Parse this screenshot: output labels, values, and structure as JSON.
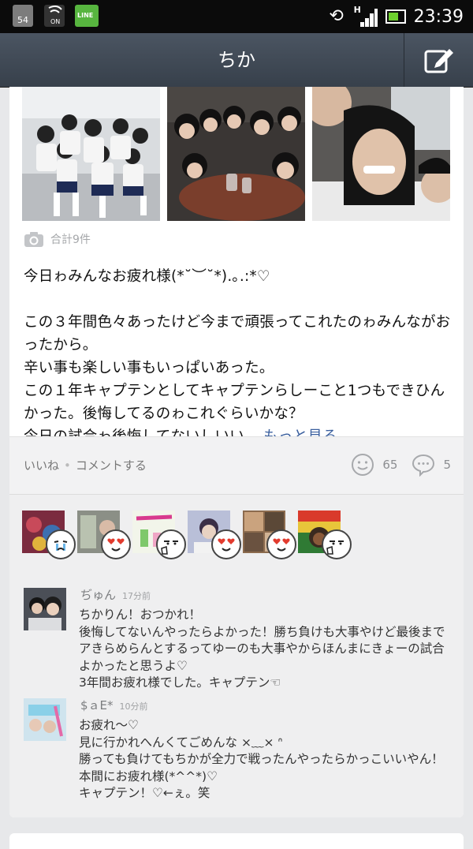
{
  "status_bar": {
    "calendar_day": "54",
    "on_label": "ON",
    "line_label": "LINE",
    "network": "H",
    "time": "23:39"
  },
  "header": {
    "title": "ちか",
    "compose_icon": "compose-icon"
  },
  "post": {
    "photo_count_label": "合計9件",
    "paragraphs": [
      "今日ゎみんなお疲れ様(*˘︶˘*).｡.:*♡",
      "この３年間色々あったけど今まで頑張ってこれたのゎみんながおったから。\n辛い事も楽しい事もいっぱいあった。\nこの１年キャプテンとしてキャプテンらしーこと1つもできひんかった。後悔してるのゎこれぐらいかな？"
    ],
    "last_line": "今日の試合ゎ後悔してないしいい...",
    "more_label": "もっと見る"
  },
  "actions": {
    "like_label": "いいね",
    "comment_label": "コメントする",
    "like_count": "65",
    "comment_count": "5"
  },
  "reactions": [
    {
      "emoji": "crying-face"
    },
    {
      "emoji": "heart-eyes"
    },
    {
      "emoji": "thumbs-up-face"
    },
    {
      "emoji": "heart-eyes"
    },
    {
      "emoji": "heart-eyes"
    },
    {
      "emoji": "thumbs-up-face"
    }
  ],
  "comments": [
    {
      "name": "ぢゅん",
      "time": "17分前",
      "text": "ちかりん！おつかれ！\n後悔してないんやったらよかった！勝ち負けも大事やけど最後までアきらめらんとするってゆーのも大事やからほんまにきょーの試合よかったと思うよ♡\n3年間お疲れ様でした。キャプテン☜"
    },
    {
      "name": "$ａE*",
      "time": "10分前",
      "text": "お疲れ〜♡\n見に行かれへんくてごめんな ×﹏× ᐢ\n勝っても負けてもちかが全力で戦ったんやったらかっこいいやん！\n本間にお疲れ様(*^^*)♡\nキャプテン！♡←ぇ。笑"
    }
  ],
  "colors": {
    "header": "#3f4853",
    "link": "#3a5f9e",
    "background": "#e7e8ea"
  }
}
